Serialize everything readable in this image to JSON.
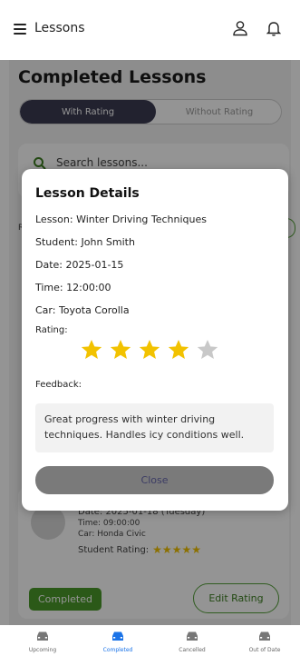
{
  "header": {
    "title": "Lessons",
    "menu_icon": "hamburger-menu-icon",
    "profile_icon": "user-icon",
    "notification_icon": "bell-icon"
  },
  "page": {
    "section_title": "Completed Lessons",
    "toggle": {
      "active": "With Rating",
      "inactive": "Without Rating"
    },
    "search": {
      "placeholder": "Search lessons..."
    },
    "lesson_card": {
      "date": "Date: 2025-01-18 (Tuesday)",
      "time": "Time: 09:00:00",
      "car": "Car: Honda Civic",
      "rating_label": "Student Rating:",
      "rating_stars": 5,
      "status": "Completed",
      "edit_button": "Edit Rating"
    }
  },
  "modal": {
    "title": "Lesson Details",
    "lesson": "Lesson: Winter Driving Techniques",
    "student": "Student: John Smith",
    "date": "Date: 2025-01-15",
    "time": "Time: 12:00:00",
    "car": "Car: Toyota Corolla",
    "rating_label": "Rating:",
    "rating_value": 4,
    "rating_max": 5,
    "feedback_label": "Feedback:",
    "feedback_text": "Great progress with winter driving techniques. Handles icy conditions well.",
    "close_button": "Close"
  },
  "bottom_nav": {
    "items": [
      {
        "label": "Upcoming",
        "icon": "car-icon",
        "active": false
      },
      {
        "label": "Completed",
        "icon": "car-icon",
        "active": true
      },
      {
        "label": "Cancelled",
        "icon": "car-icon",
        "active": false
      },
      {
        "label": "Out of Date",
        "icon": "car-icon",
        "active": false
      }
    ]
  },
  "colors": {
    "star_filled": "#f2c200",
    "star_empty": "#c8c8c8",
    "accent_blue": "#1a73e8",
    "accent_green": "#4a9a2a"
  }
}
